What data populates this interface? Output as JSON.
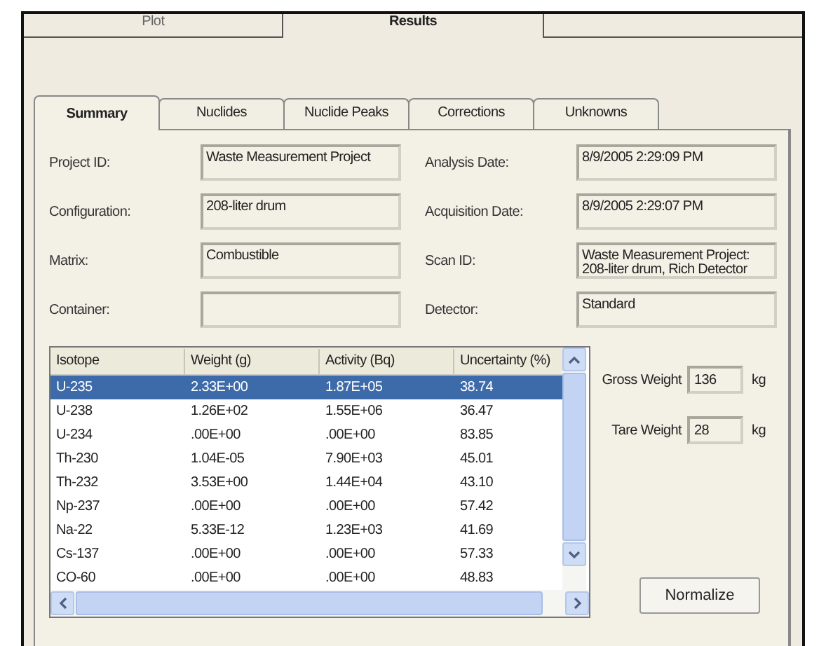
{
  "top_tabs": [
    {
      "label": "Plot",
      "selected": false
    },
    {
      "label": "Results",
      "selected": true
    },
    {
      "selected": false
    }
  ],
  "tabs": [
    {
      "label": "Summary",
      "selected": true
    },
    {
      "label": "Nuclides",
      "selected": false
    },
    {
      "label": "Nuclide Peaks",
      "selected": false
    },
    {
      "label": "Corrections",
      "selected": false
    },
    {
      "label": "Unknowns",
      "selected": false
    }
  ],
  "fields_left": [
    {
      "label": "Project ID:",
      "value": "Waste Measurement Project"
    },
    {
      "label": "Configuration:",
      "value": "208-liter drum"
    },
    {
      "label": "Matrix:",
      "value": "Combustible"
    },
    {
      "label": "Container:"
    }
  ],
  "fields_right": [
    {
      "label": "Analysis Date:",
      "value": "8/9/2005 2:29:09 PM"
    },
    {
      "label": "Acquisition Date:",
      "value": "8/9/2005 2:29:07 PM"
    },
    {
      "label": "Scan ID:",
      "value": "Waste Measurement Project: 208-liter drum, Rich Detector"
    },
    {
      "label": "Detector:",
      "value": "Standard"
    }
  ],
  "table": {
    "columns": [
      "Isotope",
      "Weight (g)",
      "Activity (Bq)",
      "Uncertainty (%)"
    ],
    "rows": [
      {
        "cells": [
          "U-235",
          "2.33E+00",
          "1.87E+05",
          "38.74"
        ],
        "selected": true
      },
      {
        "cells": [
          "U-238",
          "1.26E+02",
          "1.55E+06",
          "36.47"
        ],
        "selected": false
      },
      {
        "cells": [
          "U-234",
          ".00E+00",
          ".00E+00",
          "83.85"
        ],
        "selected": false
      },
      {
        "cells": [
          "Th-230",
          "1.04E-05",
          "7.90E+03",
          "45.01"
        ],
        "selected": false
      },
      {
        "cells": [
          "Th-232",
          "3.53E+00",
          "1.44E+04",
          "43.10"
        ],
        "selected": false
      },
      {
        "cells": [
          "Np-237",
          ".00E+00",
          ".00E+00",
          "57.42"
        ],
        "selected": false
      },
      {
        "cells": [
          "Na-22",
          "5.33E-12",
          "1.23E+03",
          "41.69"
        ],
        "selected": false
      },
      {
        "cells": [
          "Cs-137",
          ".00E+00",
          ".00E+00",
          "57.33"
        ],
        "selected": false
      },
      {
        "cells": [
          "CO-60",
          ".00E+00",
          ".00E+00",
          "48.83"
        ],
        "selected": false
      }
    ]
  },
  "weights": [
    {
      "label": "Gross Weight",
      "value": "136",
      "unit": "kg"
    },
    {
      "label": "Tare Weight",
      "value": "28",
      "unit": "kg"
    }
  ],
  "buttons": [
    "Normalize"
  ]
}
